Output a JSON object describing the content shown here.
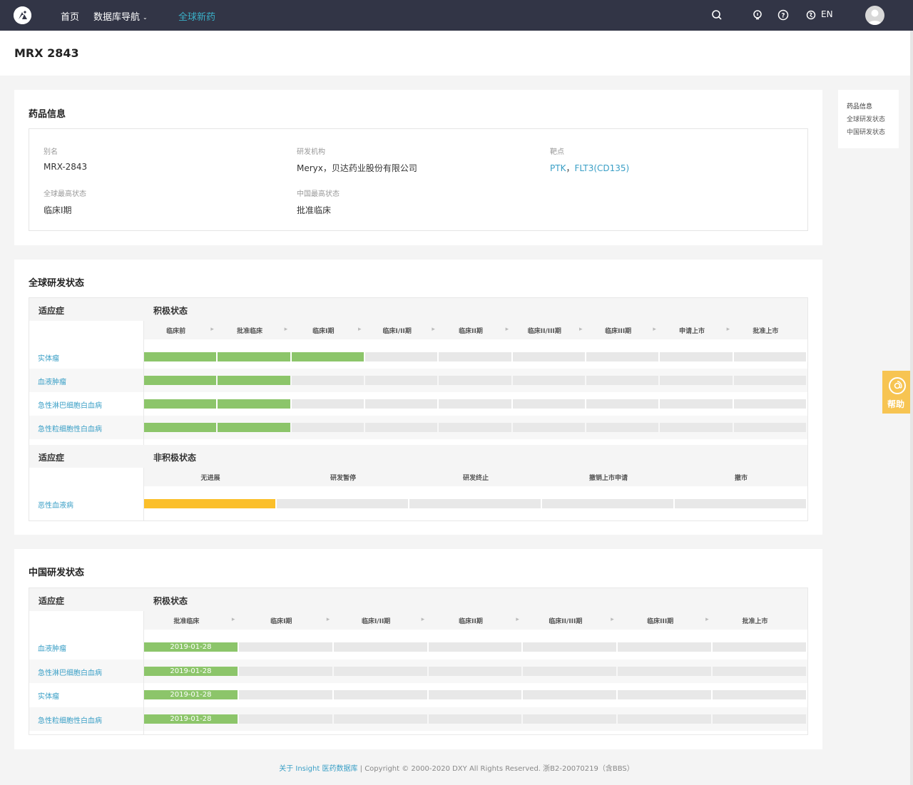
{
  "nav": {
    "logo_icon": "dxy-logo-icon",
    "home": "首页",
    "db_nav": "数据库导航",
    "global_drugs": "全球新药",
    "lang": "EN",
    "icons": [
      "search-icon",
      "lightbulb-icon",
      "help-circle-icon",
      "language-icon"
    ]
  },
  "page": {
    "title": "MRX 2843"
  },
  "drug_info": {
    "section_title": "药品信息",
    "alias_label": "别名",
    "alias_value": "MRX-2843",
    "org_label": "研发机构",
    "org_value": "Meryx，贝达药业股份有限公司",
    "target_label": "靶点",
    "target_value_1": "PTK",
    "target_sep": "，",
    "target_value_2": "FLT3(CD135)",
    "global_status_label": "全球最高状态",
    "global_status_value": "临床I期",
    "china_status_label": "中国最高状态",
    "china_status_value": "批准临床"
  },
  "global_status": {
    "section_title": "全球研发状态",
    "indication_header": "适应症",
    "active_header": "积极状态",
    "phases": [
      "临床前",
      "批准临床",
      "临床I期",
      "临床I/II期",
      "临床II期",
      "临床II/III期",
      "临床III期",
      "申请上市",
      "批准上市"
    ],
    "rows": [
      {
        "indication": "实体瘤",
        "completed": 3
      },
      {
        "indication": "血液肿瘤",
        "completed": 2
      },
      {
        "indication": "急性淋巴细胞白血病",
        "completed": 2
      },
      {
        "indication": "急性粒细胞性白血病",
        "completed": 2
      }
    ],
    "inactive_indication_header": "适应症",
    "inactive_header": "非积极状态",
    "inactive_phases": [
      "无进展",
      "研发暂停",
      "研发终止",
      "撤销上市申请",
      "撤市"
    ],
    "inactive_rows": [
      {
        "indication": "恶性血液病",
        "status_index": 0
      }
    ]
  },
  "china_status": {
    "section_title": "中国研发状态",
    "indication_header": "适应症",
    "active_header": "积极状态",
    "phases": [
      "批准临床",
      "临床I期",
      "临床I/II期",
      "临床II期",
      "临床II/III期",
      "临床III期",
      "批准上市"
    ],
    "rows": [
      {
        "indication": "血液肿瘤",
        "completed": 1,
        "date": "2019-01-28"
      },
      {
        "indication": "急性淋巴细胞白血病",
        "completed": 1,
        "date": "2019-01-28"
      },
      {
        "indication": "实体瘤",
        "completed": 1,
        "date": "2019-01-28"
      },
      {
        "indication": "急性粒细胞性白血病",
        "completed": 1,
        "date": "2019-01-28"
      }
    ]
  },
  "side_nav": {
    "items": [
      "药品信息",
      "全球研发状态",
      "中国研发状态"
    ]
  },
  "help": {
    "label": "帮助",
    "icon": "at-icon"
  },
  "footer": {
    "about": "关于 Insight 医药数据库",
    "sep": " | ",
    "copyright": "Copyright © 2000-2020 DXY All Rights Reserved. 浙B2-20070219（含BBS）"
  },
  "colors": {
    "topbar": "#323546",
    "accent": "#3a9fc6",
    "completed": "#8cc56a",
    "inactive": "#fbbf2a",
    "pending": "#e8e8e8"
  }
}
